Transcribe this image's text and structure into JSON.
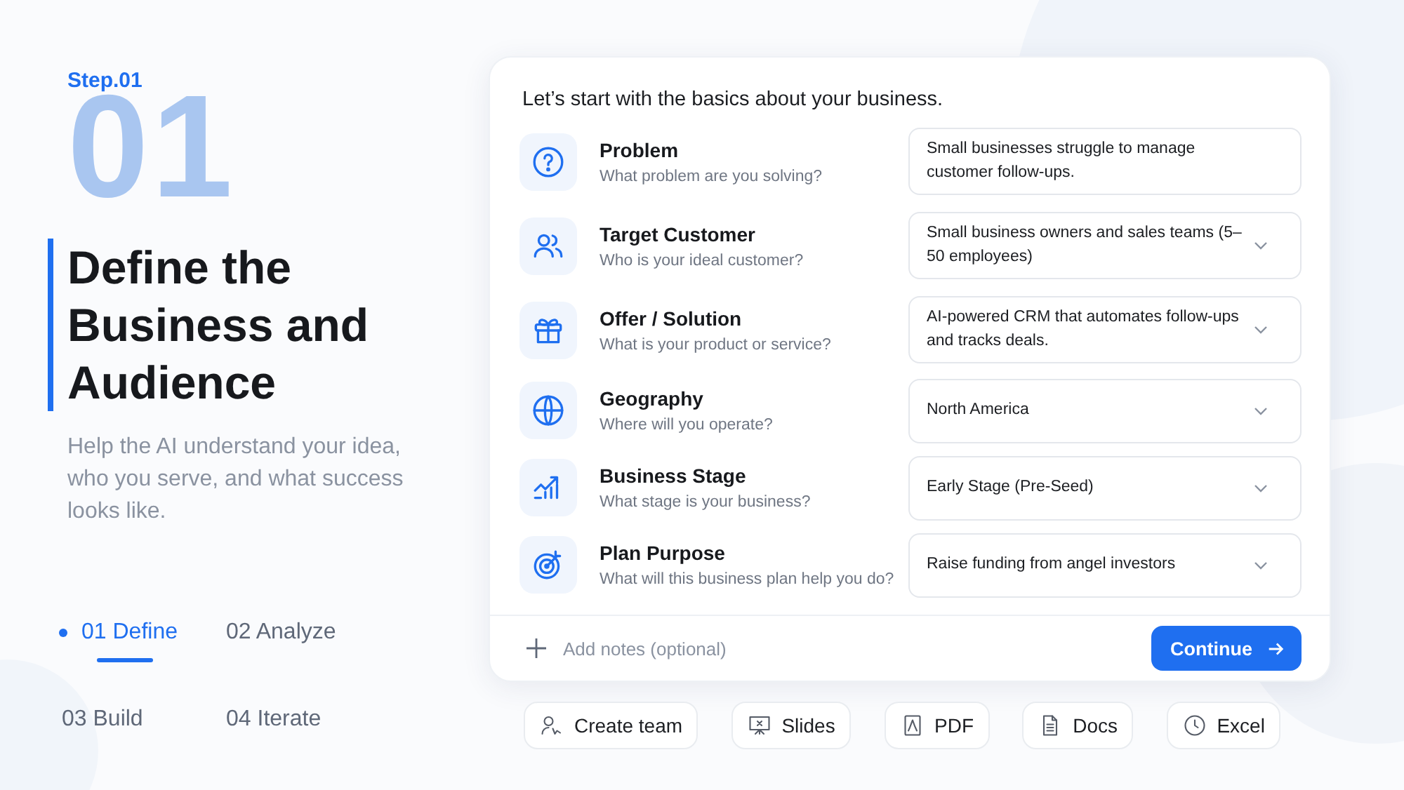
{
  "step": {
    "label": "Step.01",
    "number": "01"
  },
  "title": "Define the Business and Audience",
  "description": "Help the AI understand your idea, who you serve, and what success looks like.",
  "steps": [
    {
      "label": "01 Define",
      "selected": true
    },
    {
      "label": "02 Analyze",
      "selected": false
    },
    {
      "label": "03 Build",
      "selected": false
    },
    {
      "label": "04 Iterate",
      "selected": false
    }
  ],
  "card": {
    "heading": "Let’s start with the basics about your business.",
    "rows": [
      {
        "label": "Problem",
        "hint": "What problem are you solving?",
        "kind": "text",
        "value": "Small businesses struggle to manage customer follow-ups."
      },
      {
        "label": "Target Customer",
        "hint": "Who is your ideal customer?",
        "kind": "select",
        "value": "Small business owners and sales teams (5–50 employees)"
      },
      {
        "label": "Offer / Solution",
        "hint": "What is your product or service?",
        "kind": "select",
        "value": "AI-powered CRM that automates follow-ups and tracks deals."
      },
      {
        "label": "Geography",
        "hint": "Where will you operate?",
        "kind": "select",
        "value": "North America"
      },
      {
        "label": "Business Stage",
        "hint": "What stage is your business?",
        "kind": "select",
        "value": "Early Stage (Pre-Seed)"
      },
      {
        "label": "Plan Purpose",
        "hint": "What will this business plan help you do?",
        "kind": "select",
        "value": "Raise funding from angel investors"
      }
    ],
    "notes_placeholder": "Add notes (optional)",
    "continue": "Continue"
  },
  "actions": [
    "Create team",
    "Slides",
    "PDF",
    "Docs",
    "Excel"
  ]
}
